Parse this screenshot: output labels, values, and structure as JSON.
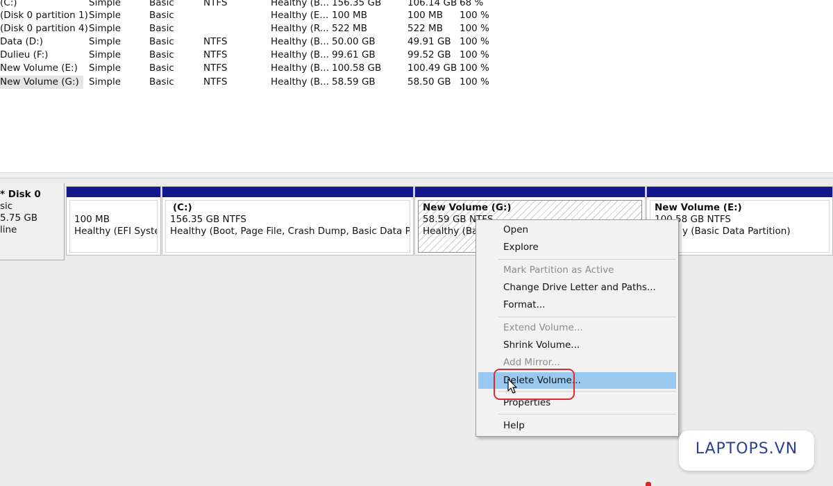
{
  "volume_list": {
    "rows": [
      {
        "volume": "(C:)",
        "layout": "Simple",
        "type": "Basic",
        "file_system": "NTFS",
        "status": "Healthy (B...",
        "capacity": "156.35 GB",
        "free_space": "106.14 GB",
        "percent_free": "68 %"
      },
      {
        "volume": "(Disk 0 partition 1)",
        "layout": "Simple",
        "type": "Basic",
        "file_system": "",
        "status": "Healthy (E...",
        "capacity": "100 MB",
        "free_space": "100 MB",
        "percent_free": "100 %"
      },
      {
        "volume": "(Disk 0 partition 4)",
        "layout": "Simple",
        "type": "Basic",
        "file_system": "",
        "status": "Healthy (R...",
        "capacity": "522 MB",
        "free_space": "522 MB",
        "percent_free": "100 %"
      },
      {
        "volume": "Data (D:)",
        "layout": "Simple",
        "type": "Basic",
        "file_system": "NTFS",
        "status": "Healthy (B...",
        "capacity": "50.00 GB",
        "free_space": "49.91 GB",
        "percent_free": "100 %"
      },
      {
        "volume": "Dulieu (F:)",
        "layout": "Simple",
        "type": "Basic",
        "file_system": "NTFS",
        "status": "Healthy (B...",
        "capacity": "99.61 GB",
        "free_space": "99.52 GB",
        "percent_free": "100 %"
      },
      {
        "volume": "New Volume (E:)",
        "layout": "Simple",
        "type": "Basic",
        "file_system": "NTFS",
        "status": "Healthy (B...",
        "capacity": "100.58 GB",
        "free_space": "100.49 GB",
        "percent_free": "100 %"
      },
      {
        "volume": "New Volume (G:)",
        "layout": "Simple",
        "type": "Basic",
        "file_system": "NTFS",
        "status": "Healthy (B...",
        "capacity": "58.59 GB",
        "free_space": "58.50 GB",
        "percent_free": "100 %",
        "selected": true
      }
    ]
  },
  "disk": {
    "name": "Disk 0",
    "type": "sic",
    "size": "5.75 GB",
    "status": "line"
  },
  "partitions": [
    {
      "name": "",
      "size": "100 MB",
      "status": "Healthy (EFI System"
    },
    {
      "name": "(C:)",
      "size": "156.35 GB NTFS",
      "status": "Healthy (Boot, Page File, Crash Dump, Basic Data Partitior"
    },
    {
      "name": "New Volume  (G:)",
      "size": "58.59 GB NTFS",
      "status": "Healthy (Basi"
    },
    {
      "name": "New Volume  (E:)",
      "size": "100.58 GB NTFS",
      "status": "y (Basic Data Partition)"
    }
  ],
  "context_menu": {
    "items": [
      {
        "label": "Open",
        "enabled": true
      },
      {
        "label": "Explore",
        "enabled": true
      },
      {
        "label": "Mark Partition as Active",
        "enabled": false
      },
      {
        "label": "Change Drive Letter and Paths...",
        "enabled": true
      },
      {
        "label": "Format...",
        "enabled": true
      },
      {
        "label": "Extend Volume...",
        "enabled": false
      },
      {
        "label": "Shrink Volume...",
        "enabled": true
      },
      {
        "label": "Add Mirror...",
        "enabled": false
      },
      {
        "label": "Delete Volume...",
        "enabled": true,
        "hovered": true
      },
      {
        "label": "Properties",
        "enabled": true
      },
      {
        "label": "Help",
        "enabled": true
      }
    ]
  },
  "watermark": {
    "text": "LAPTOPS.VN"
  },
  "colors": {
    "partition_bar": "#15188a",
    "menu_hover": "#99c9ef",
    "annotation_red": "#e0282e",
    "watermark_text": "#2a3f8f"
  }
}
